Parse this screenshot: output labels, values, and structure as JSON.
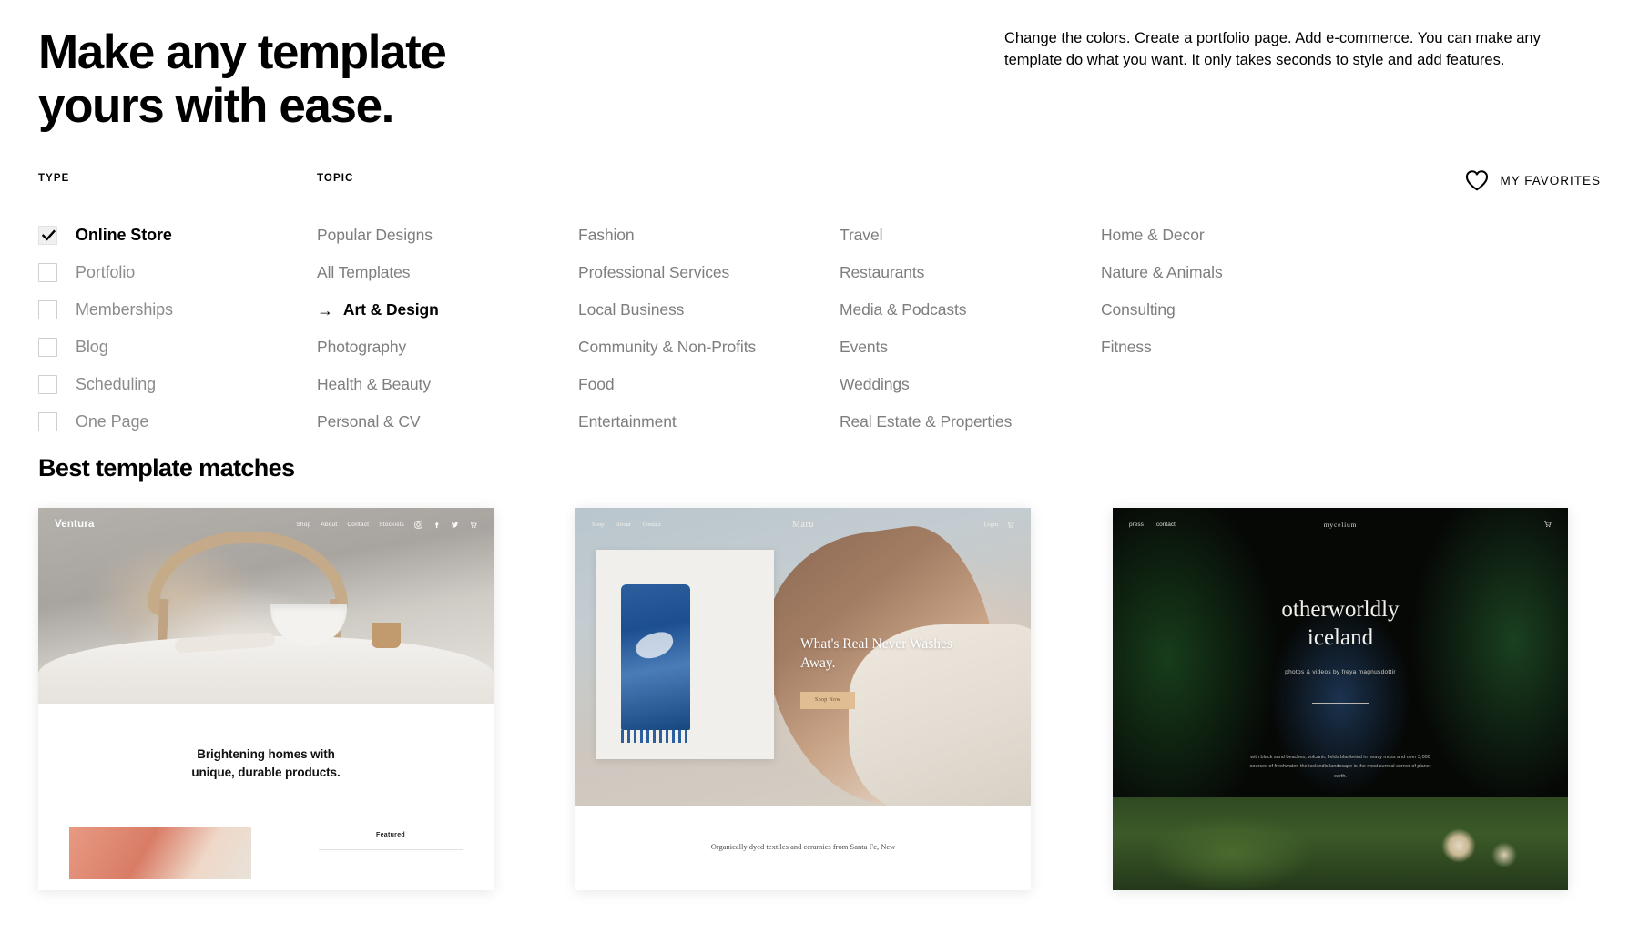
{
  "hero": {
    "title": "Make any template\nyours with ease.",
    "description": "Change the colors. Create a portfolio page. Add e-commerce. You can make any template do what you want. It only takes seconds to style and add features."
  },
  "filters": {
    "type_label": "TYPE",
    "topic_label": "TOPIC",
    "favorites": {
      "label": "MY FAVORITES",
      "icon": "heart-icon"
    },
    "types": [
      {
        "label": "Online Store",
        "checked": true
      },
      {
        "label": "Portfolio",
        "checked": false
      },
      {
        "label": "Memberships",
        "checked": false
      },
      {
        "label": "Blog",
        "checked": false
      },
      {
        "label": "Scheduling",
        "checked": false
      },
      {
        "label": "One Page",
        "checked": false
      }
    ],
    "topic_columns": [
      {
        "items": [
          {
            "label": "Popular Designs",
            "active": false
          },
          {
            "label": "All Templates",
            "active": false
          },
          {
            "label": "Art & Design",
            "active": true
          },
          {
            "label": "Photography",
            "active": false
          },
          {
            "label": "Health & Beauty",
            "active": false
          },
          {
            "label": "Personal & CV",
            "active": false
          }
        ]
      },
      {
        "items": [
          {
            "label": "Fashion",
            "active": false
          },
          {
            "label": "Professional Services",
            "active": false
          },
          {
            "label": "Local Business",
            "active": false
          },
          {
            "label": "Community & Non-Profits",
            "active": false
          },
          {
            "label": "Food",
            "active": false
          },
          {
            "label": "Entertainment",
            "active": false
          }
        ]
      },
      {
        "items": [
          {
            "label": "Travel",
            "active": false
          },
          {
            "label": "Restaurants",
            "active": false
          },
          {
            "label": "Media & Podcasts",
            "active": false
          },
          {
            "label": "Events",
            "active": false
          },
          {
            "label": "Weddings",
            "active": false
          },
          {
            "label": "Real Estate & Properties",
            "active": false
          }
        ]
      },
      {
        "items": [
          {
            "label": "Home & Decor",
            "active": false
          },
          {
            "label": "Nature & Animals",
            "active": false
          },
          {
            "label": "Consulting",
            "active": false
          },
          {
            "label": "Fitness",
            "active": false
          }
        ]
      }
    ],
    "active_arrow": "→"
  },
  "results": {
    "title": "Best template matches",
    "cards": [
      {
        "brand": "Ventura",
        "nav": [
          "Shop",
          "About",
          "Contact",
          "Stockists"
        ],
        "social": [
          "instagram-icon",
          "facebook-icon",
          "twitter-icon",
          "cart-icon"
        ],
        "headline": "Brightening homes with\nunique, durable products.",
        "featured_label": "Featured"
      },
      {
        "brand": "Maru",
        "nav": [
          "Shop",
          "About",
          "Contact"
        ],
        "account": "Login",
        "headline": "What's Real Never Washes\nAway.",
        "button": "Shop Now",
        "caption": "Organically dyed textiles and ceramics from Santa Fe, New"
      },
      {
        "brand": "mycelium",
        "nav": [
          "press",
          "contact"
        ],
        "cart": " ",
        "title": "otherworldly\niceland",
        "subtitle": "photos & videos by freya magnusdottir",
        "paragraph": "with black sand beaches, volcanic fields blanketed in heavy moss and over 3,000\nsources of freshwater, the icelandic landscape is the most surreal corner of planet\nearth."
      }
    ]
  }
}
